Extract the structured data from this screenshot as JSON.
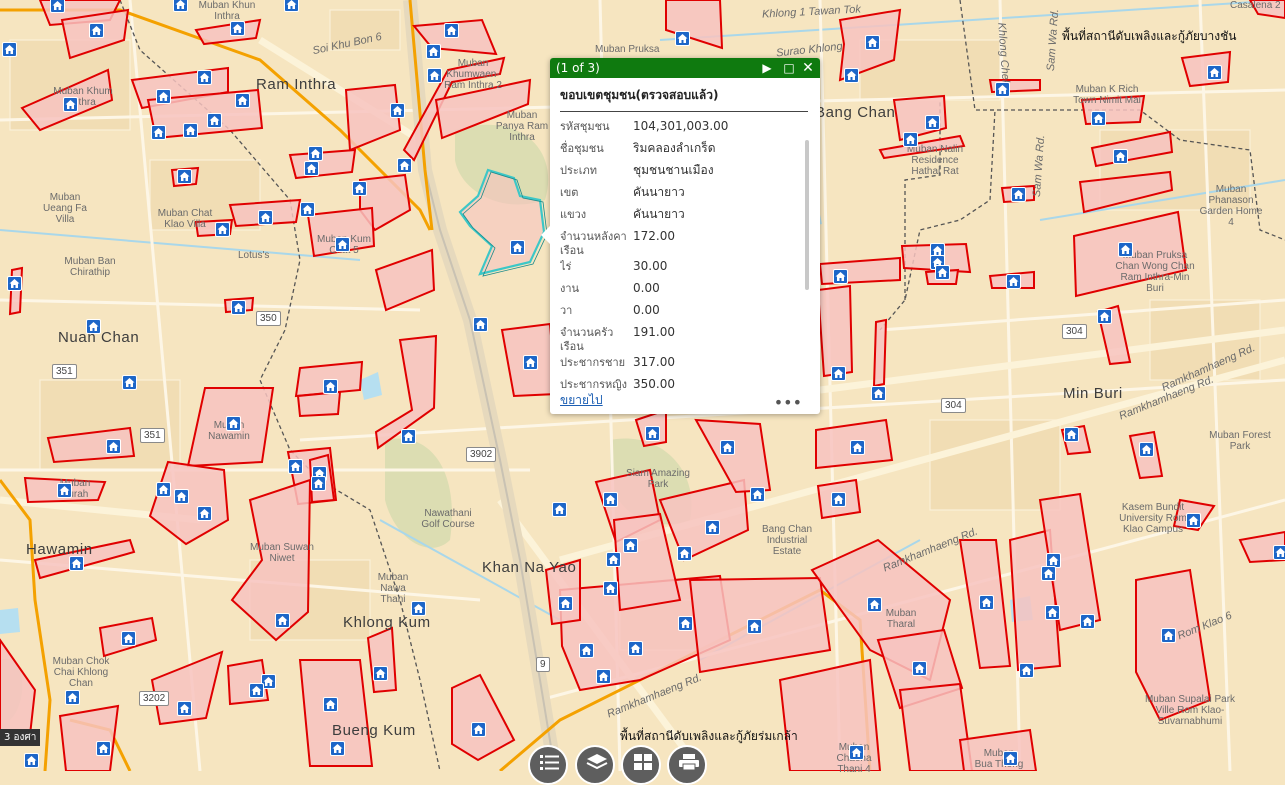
{
  "map": {
    "place_labels": [
      "Ram Inthra",
      "Bang Chan",
      "Nuan Chan",
      "Min Buri",
      "Hawamin",
      "Khan Na Yao",
      "Khlong Kum",
      "Bueng Kum"
    ],
    "small_labels": [
      "Muban Khum Inthra",
      "Soi Khu Bon 6",
      "Muban Khun Inthra",
      "Muban Pruksa",
      "Muban Khumwaen-Ram Inthra 2",
      "Muban Panya Ram Inthra",
      "Muban Ueang Fa Villa",
      "Muban Chat Klao Villa",
      "Muban Ban Chirathip",
      "Lotus's",
      "Muban Kum Chat 5",
      "Muban Surah",
      "Muban Nawamin",
      "Nawathani Golf Course",
      "Siam Amazing Park",
      "Bang Chan Industrial Estate",
      "Muban Suwan Niwet",
      "Muban Nawa Thani",
      "Muban Chok Chai Khlong Chan",
      "Muban Nalin Residence Hathai Rat",
      "Muban K Rich Town Nimit Mai",
      "Muban Phanason Garden Home 4",
      "Muban Pruksa Chan Wong Chan Ram Inthra-Min Buri",
      "Muban Forest Park",
      "Kasem Bundit University Rom Klao Campus",
      "Muban Tharal",
      "Muban Supalai Park Ville Rom Klao-Suvarnabhumi",
      "Muban Chaeha Thani 4",
      "Muban Bua Thong",
      "Casalena 2"
    ],
    "road_labels": [
      "Khlong 1 Tawan Tok",
      "Surao Khlong",
      "Khlong Chek",
      "Sam Wa Rd.",
      "Sam Wa Rd.",
      "Ramkhamhaeng Rd.",
      "Ramkhamhaeng Rd.",
      "Ramkhamhaeng Rd.",
      "Rom Klao 6",
      "Ramkhamhaeng Rd."
    ],
    "shields": [
      "350",
      "351",
      "351",
      "3902",
      "304",
      "304",
      "9",
      "3202"
    ],
    "district_labels": [
      "พื้นที่สถานีดับเพลิงและกู้ภัยบางชัน",
      "พื้นที่สถานีดับเพลิงและกู้ภัยร่มเกล้า"
    ],
    "scale_text": "3 องศา",
    "colors": {
      "boundary": "#e00000",
      "fill": "#f7c3c0",
      "marker": "#1d66c8",
      "highway": "#f4a100",
      "selected": "#3cc7c7"
    }
  },
  "popup": {
    "counter": "(1 of 3)",
    "title": "ขอบเขตชุมชน(ตรวจสอบแล้ว)",
    "fields": [
      {
        "key": "รหัสชุมชน",
        "value": "104,301,003.00"
      },
      {
        "key": "ชื่อชุมชน",
        "value": "ริมคลองลำเกร็ด"
      },
      {
        "key": "ประเภท",
        "value": "ชุมชนชานเมือง"
      },
      {
        "key": "เขต",
        "value": "คันนายาว"
      },
      {
        "key": "แขวง",
        "value": "คันนายาว"
      },
      {
        "key": "จำนวนหลังคาเรือน",
        "value": "172.00"
      },
      {
        "key": "ไร่",
        "value": "30.00"
      },
      {
        "key": "งาน",
        "value": "0.00"
      },
      {
        "key": "วา",
        "value": "0.00"
      },
      {
        "key": "จำนวนครัวเรือน",
        "value": "191.00"
      },
      {
        "key": "ประชากรชาย",
        "value": "317.00"
      },
      {
        "key": "ประชากรหญิง",
        "value": "350.00"
      }
    ],
    "zoom_label": "ขยายไป",
    "more_label": "•••"
  },
  "toolbar": [
    "legend-icon",
    "layers-icon",
    "basemap-icon",
    "print-icon"
  ]
}
